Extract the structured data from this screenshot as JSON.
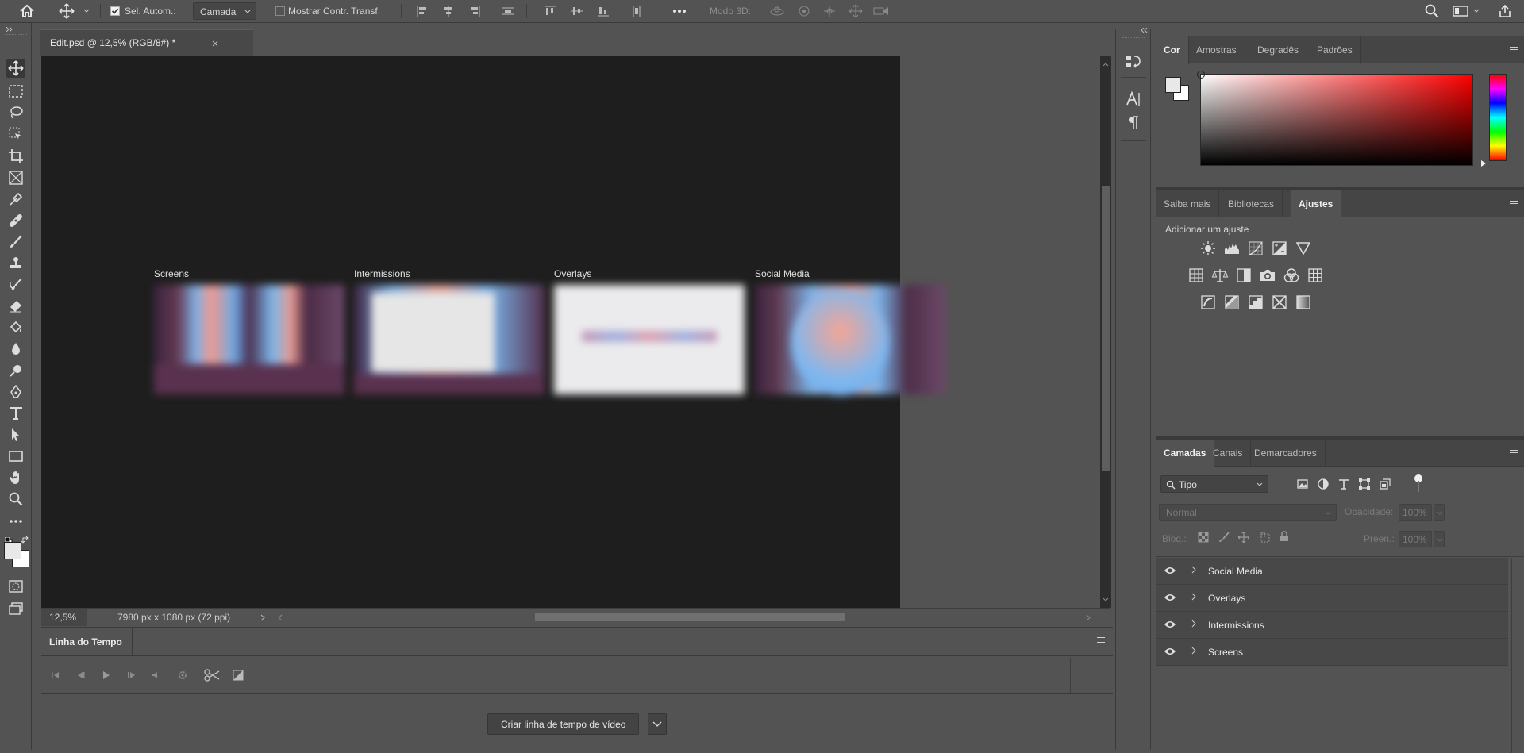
{
  "options_bar": {
    "auto_select_label": "Sel. Autom.:",
    "auto_select_checked": true,
    "auto_select_target": "Camada",
    "show_transform_label": "Mostrar Contr. Transf.",
    "show_transform_checked": false,
    "mode_3d_label": "Modo 3D:"
  },
  "document": {
    "tab_title": "Edit.psd @ 12,5% (RGB/8#) *",
    "zoom": "12,5%",
    "dimensions": "7980 px x 1080 px (72 ppi)",
    "artboards": [
      {
        "label": "Screens"
      },
      {
        "label": "Intermissions"
      },
      {
        "label": "Overlays"
      },
      {
        "label": "Social Media"
      }
    ]
  },
  "timeline": {
    "tab_label": "Linha do Tempo",
    "create_button": "Criar linha de tempo de vídeo"
  },
  "color_panel": {
    "tabs": [
      "Cor",
      "Amostras",
      "Degradês",
      "Padrões"
    ],
    "active_tab": "Cor",
    "hue_color": "#ff0000"
  },
  "adjust_panel": {
    "tabs": [
      "Saiba mais",
      "Bibliotecas",
      "Ajustes"
    ],
    "active_tab": "Ajustes",
    "heading": "Adicionar um ajuste"
  },
  "layers_panel": {
    "tabs": [
      "Camadas",
      "Canais",
      "Demarcadores"
    ],
    "active_tab": "Camadas",
    "filter_kind": "Tipo",
    "blend_mode": "Normal",
    "opacity_label": "Opacidade:",
    "opacity_value": "100%",
    "lock_label": "Bloq.:",
    "fill_label": "Preen.:",
    "fill_value": "100%",
    "layers": [
      {
        "name": "Social Media"
      },
      {
        "name": "Overlays"
      },
      {
        "name": "Intermissions"
      },
      {
        "name": "Screens"
      }
    ]
  }
}
